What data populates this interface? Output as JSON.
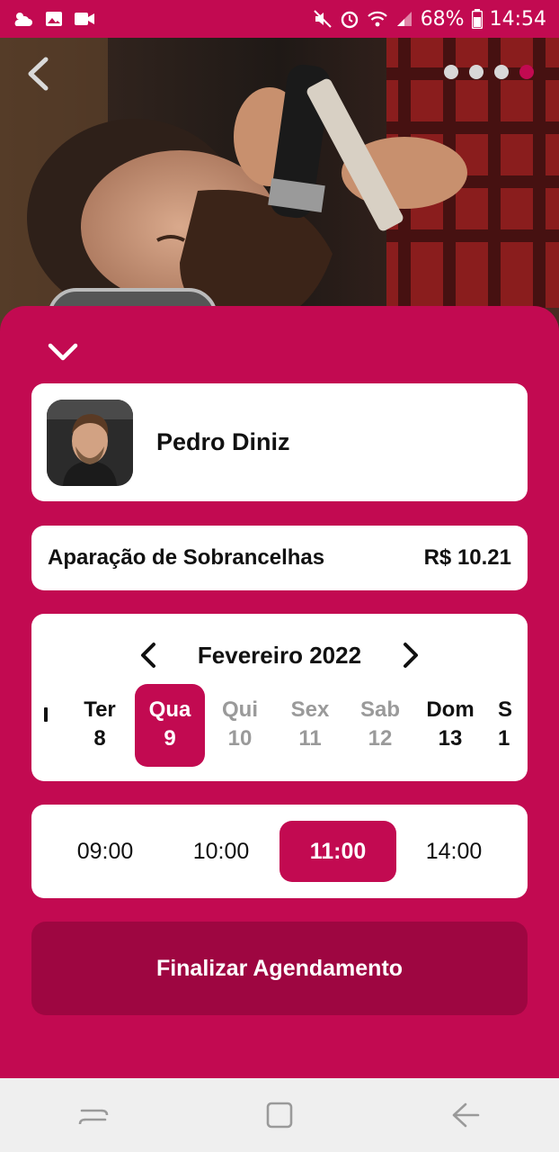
{
  "status_bar": {
    "battery": "68%",
    "time": "14:54",
    "icons": [
      "weather-icon",
      "image-icon",
      "video-icon",
      "mute-icon",
      "alarm-icon",
      "wifi-icon",
      "signal-icon",
      "battery-icon"
    ]
  },
  "hero": {
    "image_icon": "barber-photo",
    "carousel_dots": 4,
    "carousel_active_index": 3
  },
  "professional": {
    "name": "Pedro Diniz",
    "avatar": "avatar-photo"
  },
  "service": {
    "name": "Aparação de Sobrancelhas",
    "price": "R$ 10.21"
  },
  "calendar": {
    "month": "Fevereiro 2022",
    "days": [
      {
        "name": "Ter",
        "num": "8",
        "state": "available"
      },
      {
        "name": "Qua",
        "num": "9",
        "state": "selected"
      },
      {
        "name": "Qui",
        "num": "10",
        "state": "unavailable"
      },
      {
        "name": "Sex",
        "num": "11",
        "state": "unavailable"
      },
      {
        "name": "Sab",
        "num": "12",
        "state": "unavailable"
      },
      {
        "name": "Dom",
        "num": "13",
        "state": "available"
      },
      {
        "name": "S",
        "num": "1",
        "state": "available"
      }
    ]
  },
  "times": {
    "slots": [
      "09:00",
      "10:00",
      "11:00",
      "14:00"
    ],
    "selected": "11:00"
  },
  "actions": {
    "finish_label": "Finalizar Agendamento"
  },
  "colors": {
    "brand": "#c20a51",
    "button_dark": "#9e0641",
    "muted_text": "#9a9a9a"
  }
}
